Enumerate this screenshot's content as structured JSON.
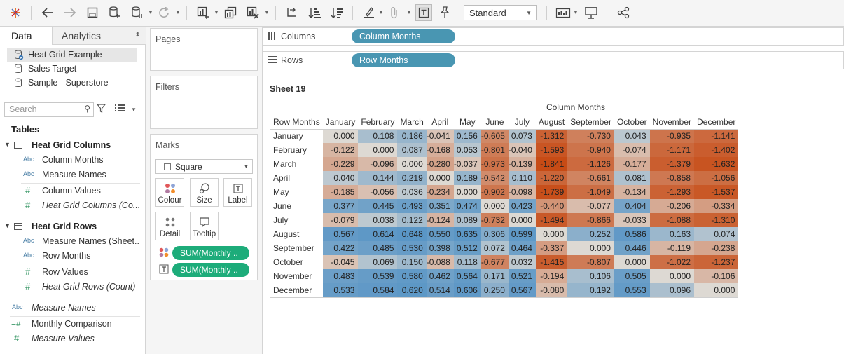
{
  "toolbar": {
    "icons": [
      "tableau-logo-icon",
      "undo-icon",
      "redo-icon",
      "save-icon",
      "new-datasource-icon",
      "pause-updates-icon",
      "refresh-icon",
      "new-worksheet-icon",
      "duplicate-sheet-icon",
      "clear-sheet-icon",
      "swap-rows-columns-icon",
      "sort-ascending-icon",
      "sort-descending-icon",
      "highlight-icon",
      "group-members-icon",
      "show-mark-labels-icon",
      "fix-axes-icon",
      "show-me-icon",
      "presentation-mode-icon",
      "share-icon"
    ],
    "fit_select": "Standard"
  },
  "data_pane": {
    "tab_data": "Data",
    "tab_analytics": "Analytics",
    "datasources": [
      "Heat Grid Example",
      "Sales Target",
      "Sample - Superstore"
    ],
    "search_placeholder": "Search",
    "tables_heading": "Tables",
    "table1": {
      "name": "Heat Grid Columns",
      "fields": [
        {
          "type": "Abc",
          "label": "Column Months"
        },
        {
          "type": "Abc",
          "label": "Measure Names"
        },
        {
          "type": "#",
          "label": "Column Values"
        },
        {
          "type": "#",
          "label": "Heat Grid Columns (Co..."
        }
      ]
    },
    "table2": {
      "name": "Heat Grid Rows",
      "fields": [
        {
          "type": "Abc",
          "label": "Measure Names (Sheet..."
        },
        {
          "type": "Abc",
          "label": "Row Months"
        },
        {
          "type": "#",
          "label": "Row Values"
        },
        {
          "type": "#",
          "label": "Heat Grid Rows (Count)"
        }
      ]
    },
    "extra_fields": [
      {
        "type": "Abc",
        "label": "Measure Names"
      },
      {
        "type": "=#",
        "label": "Monthly Comparison"
      },
      {
        "type": "#",
        "label": "Measure Values"
      }
    ]
  },
  "cards": {
    "pages": "Pages",
    "filters": "Filters",
    "marks": "Marks",
    "mark_type": "Square",
    "mark_buttons": [
      "Colour",
      "Size",
      "Label",
      "Detail",
      "Tooltip"
    ],
    "mark_pills": [
      "SUM(Monthly ..",
      "SUM(Monthly .."
    ]
  },
  "shelves": {
    "columns_label": "Columns",
    "columns_pill": "Column Months",
    "rows_label": "Rows",
    "rows_pill": "Row Months"
  },
  "sheet": {
    "title": "Sheet 19",
    "column_header_title": "Column Months",
    "row_header_title": "Row Months",
    "months": [
      "January",
      "February",
      "March",
      "April",
      "May",
      "June",
      "July",
      "August",
      "September",
      "October",
      "November",
      "December"
    ],
    "values": [
      [
        "0.000",
        "0.108",
        "0.186",
        "-0.041",
        "0.156",
        "-0.605",
        "0.073",
        "-1.312",
        "-0.730",
        "0.043",
        "-0.935",
        "-1.141"
      ],
      [
        "-0.122",
        "0.000",
        "0.087",
        "-0.168",
        "0.053",
        "-0.801",
        "-0.040",
        "-1.593",
        "-0.940",
        "-0.074",
        "-1.171",
        "-1.402"
      ],
      [
        "-0.229",
        "-0.096",
        "0.000",
        "-0.280",
        "-0.037",
        "-0.973",
        "-0.139",
        "-1.841",
        "-1.126",
        "-0.177",
        "-1.379",
        "-1.632"
      ],
      [
        "0.040",
        "0.144",
        "0.219",
        "0.000",
        "0.189",
        "-0.542",
        "0.110",
        "-1.220",
        "-0.661",
        "0.081",
        "-0.858",
        "-1.056"
      ],
      [
        "-0.185",
        "-0.056",
        "0.036",
        "-0.234",
        "0.000",
        "-0.902",
        "-0.098",
        "-1.739",
        "-1.049",
        "-0.134",
        "-1.293",
        "-1.537"
      ],
      [
        "0.377",
        "0.445",
        "0.493",
        "0.351",
        "0.474",
        "0.000",
        "0.423",
        "-0.440",
        "-0.077",
        "0.404",
        "-0.206",
        "-0.334"
      ],
      [
        "-0.079",
        "0.038",
        "0.122",
        "-0.124",
        "0.089",
        "-0.732",
        "0.000",
        "-1.494",
        "-0.866",
        "-0.033",
        "-1.088",
        "-1.310"
      ],
      [
        "0.567",
        "0.614",
        "0.648",
        "0.550",
        "0.635",
        "0.306",
        "0.599",
        "0.000",
        "0.252",
        "0.586",
        "0.163",
        "0.074"
      ],
      [
        "0.422",
        "0.485",
        "0.530",
        "0.398",
        "0.512",
        "0.072",
        "0.464",
        "-0.337",
        "0.000",
        "0.446",
        "-0.119",
        "-0.238"
      ],
      [
        "-0.045",
        "0.069",
        "0.150",
        "-0.088",
        "0.118",
        "-0.677",
        "0.032",
        "-1.415",
        "-0.807",
        "0.000",
        "-1.022",
        "-1.237"
      ],
      [
        "0.483",
        "0.539",
        "0.580",
        "0.462",
        "0.564",
        "0.171",
        "0.521",
        "-0.194",
        "0.106",
        "0.505",
        "0.000",
        "-0.106"
      ],
      [
        "0.533",
        "0.584",
        "0.620",
        "0.514",
        "0.606",
        "0.250",
        "0.567",
        "-0.080",
        "0.192",
        "0.553",
        "0.096",
        "0.000"
      ]
    ]
  }
}
